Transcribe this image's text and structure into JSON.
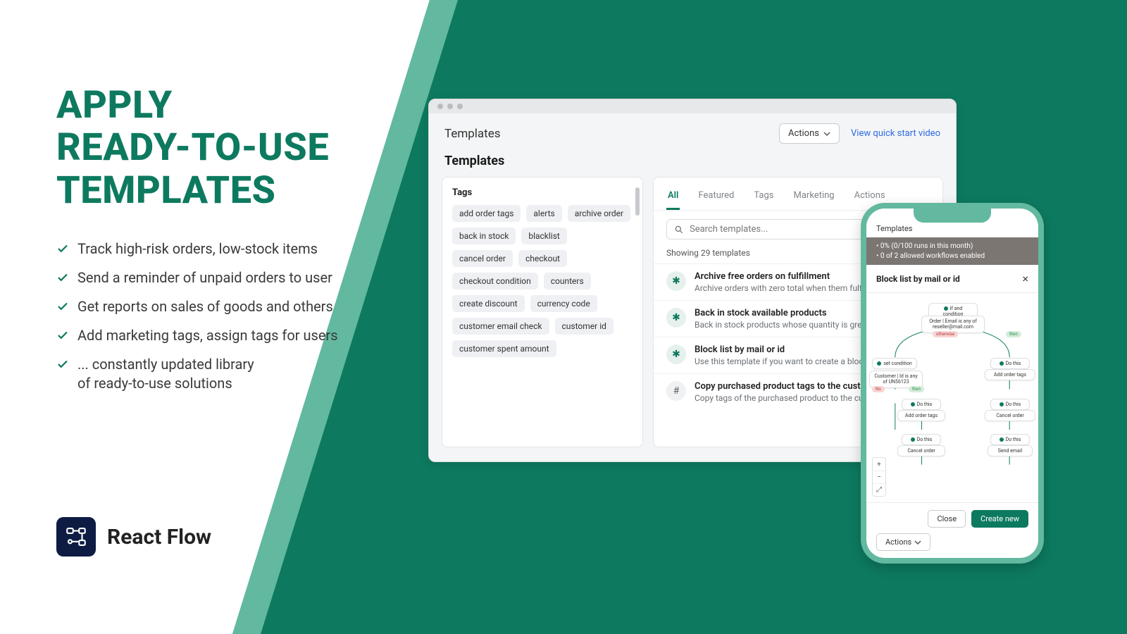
{
  "headline": "APPLY\nREADY-TO-USE\nTEMPLATES",
  "bullets": [
    "Track high-risk orders, low-stock items",
    "Send a reminder of unpaid orders to user",
    "Get reports on sales of goods and others",
    "Add marketing tags, assign tags for users",
    "... constantly updated library\nof ready-to-use solutions"
  ],
  "brand": "React Flow",
  "window": {
    "headerTitle": "Templates",
    "actionsBtn": "Actions",
    "videoLink": "View quick start video",
    "sectionTitle": "Templates",
    "tagsHead": "Tags",
    "tags": [
      "add order tags",
      "alerts",
      "archive order",
      "back in stock",
      "blacklist",
      "cancel order",
      "checkout",
      "checkout condition",
      "counters",
      "create discount",
      "currency code",
      "customer email check",
      "customer id",
      "customer spent amount"
    ],
    "tabs": [
      "All",
      "Featured",
      "Tags",
      "Marketing",
      "Actions"
    ],
    "searchPlaceholder": "Search templates...",
    "resultCount": "Showing 29 templates",
    "templates": [
      {
        "title": "Archive free orders on fulfillment",
        "desc": "Archive orders with zero total when them fulfilled.",
        "icon": "spark"
      },
      {
        "title": "Back in stock available products",
        "desc": "Back in stock products whose quantity is greater than",
        "icon": "spark"
      },
      {
        "title": "Block list by mail or id",
        "desc": "Use this template if you want to create a block list of customers by mail or user id.",
        "icon": "spark"
      },
      {
        "title": "Copy purchased product tags to the customer",
        "desc": "Copy tags of the purchased product to the customer.",
        "icon": "hash"
      }
    ]
  },
  "phone": {
    "breadcrumb": "Templates",
    "bannerLine1": "• 0% (0/100 runs in this month)",
    "bannerLine2": "• 0 of 2 allowed workflows enabled",
    "title": "Block list by mail or id",
    "nodes": {
      "ifCond": "If and condition",
      "orderEmail": "Order | Email is any of reseller@mail.com",
      "setCond": "set condition",
      "customerId": "Customer | Id is any of UN56123",
      "doThisA": "Do this",
      "addTagsA": "Add order tags",
      "doThisB": "Do this",
      "addTagsB": "Add order tags",
      "cancelOrderA": "Cancel order",
      "doThisC": "Do this",
      "cancelOrderB": "Cancel order",
      "doThisD": "Do this",
      "sendEmail": "Send email",
      "otherwise": "otherwise",
      "then": "then",
      "noLabel": "No",
      "thenLabel": "then"
    },
    "closeBtn": "Close",
    "createBtn": "Create new",
    "actionsBtn": "Actions"
  }
}
